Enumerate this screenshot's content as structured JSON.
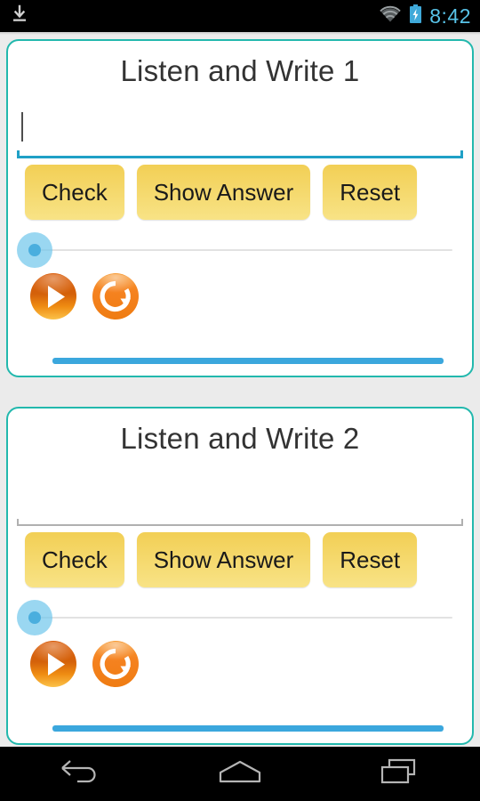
{
  "statusbar": {
    "download_icon": "download-icon",
    "wifi_icon": "wifi-icon",
    "battery_icon": "battery-charging-icon",
    "time": "8:42"
  },
  "cards": [
    {
      "title": "Listen and Write 1",
      "input": {
        "value": "",
        "focused": true,
        "caret_visible": true
      },
      "buttons": [
        {
          "label": "Check",
          "name": "check-button"
        },
        {
          "label": "Show Answer",
          "name": "show-answer-button"
        },
        {
          "label": "Reset",
          "name": "reset-button"
        }
      ],
      "seekbar": {
        "value": 0,
        "min": 0,
        "max": 100
      },
      "media": [
        {
          "name": "play-button",
          "icon": "play-icon"
        },
        {
          "name": "replay-button",
          "icon": "replay-icon"
        }
      ],
      "progress": {
        "value": 100,
        "color": "#3ba7dd"
      }
    },
    {
      "title": "Listen and Write 2",
      "input": {
        "value": "",
        "focused": false,
        "caret_visible": false
      },
      "buttons": [
        {
          "label": "Check",
          "name": "check-button"
        },
        {
          "label": "Show Answer",
          "name": "show-answer-button"
        },
        {
          "label": "Reset",
          "name": "reset-button"
        }
      ],
      "seekbar": {
        "value": 0,
        "min": 0,
        "max": 100
      },
      "media": [
        {
          "name": "play-button",
          "icon": "play-icon"
        },
        {
          "name": "replay-button",
          "icon": "replay-icon"
        }
      ],
      "progress": {
        "value": 100,
        "color": "#3ba7dd"
      }
    }
  ],
  "navbar": {
    "back": "back-icon",
    "home": "home-icon",
    "recents": "recents-icon"
  },
  "colors": {
    "card_border": "#22b8ad",
    "background": "#ebebeb",
    "button": "#f2cf55",
    "accent_blue": "#3ba7dd",
    "play_orange": "#e8730d",
    "status_time": "#58c3e8"
  }
}
